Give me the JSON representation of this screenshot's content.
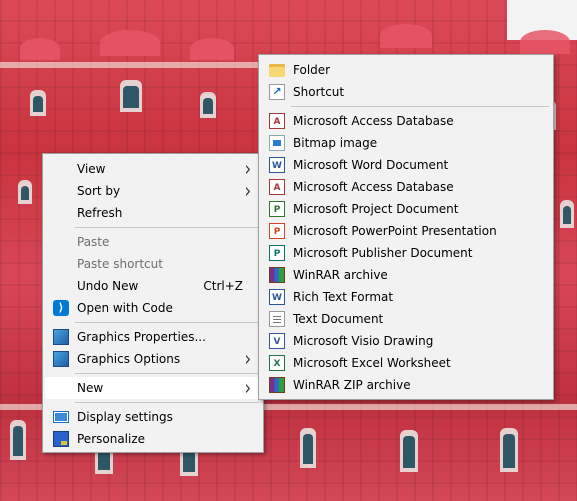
{
  "context_menu": {
    "items": [
      {
        "label": "View",
        "has_submenu": true
      },
      {
        "label": "Sort by",
        "has_submenu": true
      },
      {
        "label": "Refresh"
      },
      {
        "label": "Paste",
        "disabled": true
      },
      {
        "label": "Paste shortcut",
        "disabled": true
      },
      {
        "label": "Undo New",
        "shortcut": "Ctrl+Z"
      },
      {
        "label": "Open with Code",
        "icon": "vscode-icon"
      },
      {
        "label": "Graphics Properties...",
        "icon": "graphics-icon"
      },
      {
        "label": "Graphics Options",
        "icon": "graphics-icon",
        "has_submenu": true
      },
      {
        "label": "New",
        "has_submenu": true,
        "highlighted": true
      },
      {
        "label": "Display settings",
        "icon": "display-icon"
      },
      {
        "label": "Personalize",
        "icon": "personalize-icon"
      }
    ]
  },
  "new_submenu": {
    "items": [
      {
        "label": "Folder",
        "icon": "folder-icon"
      },
      {
        "label": "Shortcut",
        "icon": "shortcut-icon"
      },
      {
        "label": "Microsoft Access Database",
        "icon": "access-icon"
      },
      {
        "label": "Bitmap image",
        "icon": "bitmap-icon"
      },
      {
        "label": "Microsoft Word Document",
        "icon": "word-icon"
      },
      {
        "label": "Microsoft Access Database",
        "icon": "access-icon"
      },
      {
        "label": "Microsoft Project Document",
        "icon": "project-icon"
      },
      {
        "label": "Microsoft PowerPoint Presentation",
        "icon": "powerpoint-icon"
      },
      {
        "label": "Microsoft Publisher Document",
        "icon": "publisher-icon"
      },
      {
        "label": "WinRAR archive",
        "icon": "winrar-icon"
      },
      {
        "label": "Rich Text Format",
        "icon": "rtf-icon"
      },
      {
        "label": "Text Document",
        "icon": "text-document-icon"
      },
      {
        "label": "Microsoft Visio Drawing",
        "icon": "visio-icon"
      },
      {
        "label": "Microsoft Excel Worksheet",
        "icon": "excel-icon"
      },
      {
        "label": "WinRAR ZIP archive",
        "icon": "winrar-zip-icon"
      }
    ]
  },
  "colors": {
    "menu_background": "#f2f2f2",
    "highlight": "#ffffff",
    "disabled_text": "#6e6e6e",
    "wallpaper": "#cf3a4a"
  }
}
